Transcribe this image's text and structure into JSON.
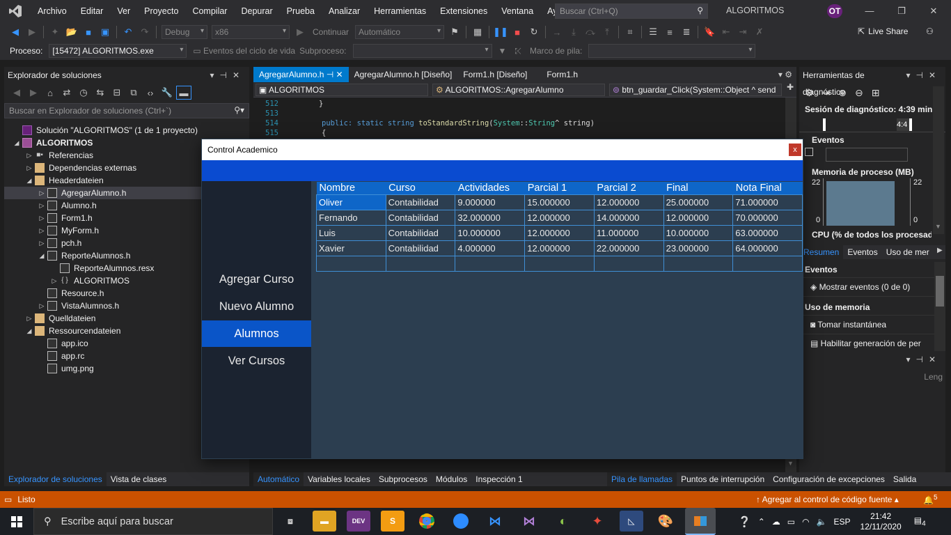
{
  "menu": {
    "items": [
      "Archivo",
      "Editar",
      "Ver",
      "Proyecto",
      "Compilar",
      "Depurar",
      "Prueba",
      "Analizar",
      "Herramientas",
      "Extensiones",
      "Ventana",
      "Ayuda"
    ],
    "search_placeholder": "Buscar (Ctrl+Q)",
    "solution_name": "ALGORITMOS",
    "user_initials": "OT"
  },
  "toolbar": {
    "config": "Debug",
    "platform": "x86",
    "continue_label": "Continuar",
    "auto_label": "Automático",
    "live_share": "Live Share"
  },
  "toolbar2": {
    "process_label": "Proceso:",
    "process_value": "[15472] ALGORITMOS.exe",
    "lifecycle": "Eventos del ciclo de vida",
    "subprocess": "Subproceso:",
    "stackframe": "Marco de pila:"
  },
  "solution_explorer": {
    "title": "Explorador de soluciones",
    "search_placeholder": "Buscar en Explorador de soluciones (Ctrl+`)",
    "nodes": [
      {
        "label": "Solución \"ALGORITMOS\" (1 de 1 proyecto)",
        "indent": 0,
        "arrow": "",
        "icon": "sln"
      },
      {
        "label": "ALGORITMOS",
        "indent": 0,
        "arrow": "◢",
        "icon": "proj",
        "bold": true
      },
      {
        "label": "Referencias",
        "indent": 1,
        "arrow": "▷",
        "icon": "ref"
      },
      {
        "label": "Dependencias externas",
        "indent": 1,
        "arrow": "▷",
        "icon": "folder"
      },
      {
        "label": "Headerdateien",
        "indent": 1,
        "arrow": "◢",
        "icon": "folder"
      },
      {
        "label": "AgregarAlumno.h",
        "indent": 2,
        "arrow": "▷",
        "icon": "file",
        "selected": true
      },
      {
        "label": "Alumno.h",
        "indent": 2,
        "arrow": "▷",
        "icon": "file"
      },
      {
        "label": "Form1.h",
        "indent": 2,
        "arrow": "▷",
        "icon": "file"
      },
      {
        "label": "MyForm.h",
        "indent": 2,
        "arrow": "▷",
        "icon": "file"
      },
      {
        "label": "pch.h",
        "indent": 2,
        "arrow": "▷",
        "icon": "file"
      },
      {
        "label": "ReporteAlumnos.h",
        "indent": 2,
        "arrow": "◢",
        "icon": "file"
      },
      {
        "label": "ReporteAlumnos.resx",
        "indent": 3,
        "arrow": "",
        "icon": "file"
      },
      {
        "label": "ALGORITMOS",
        "indent": 3,
        "arrow": "▷",
        "icon": "ref"
      },
      {
        "label": "Resource.h",
        "indent": 2,
        "arrow": "",
        "icon": "file"
      },
      {
        "label": "VistaAlumnos.h",
        "indent": 2,
        "arrow": "▷",
        "icon": "file"
      },
      {
        "label": "Quelldateien",
        "indent": 1,
        "arrow": "▷",
        "icon": "folder"
      },
      {
        "label": "Ressourcendateien",
        "indent": 1,
        "arrow": "◢",
        "icon": "folder"
      },
      {
        "label": "app.ico",
        "indent": 2,
        "arrow": "",
        "icon": "file"
      },
      {
        "label": "app.rc",
        "indent": 2,
        "arrow": "",
        "icon": "file"
      },
      {
        "label": "umg.png",
        "indent": 2,
        "arrow": "",
        "icon": "file"
      }
    ],
    "bottom_tabs": [
      "Explorador de soluciones",
      "Vista de clases"
    ]
  },
  "editor": {
    "tabs": [
      "AgregarAlumno.h",
      "AgregarAlumno.h [Diseño]",
      "Form1.h [Diseño]",
      "Form1.h"
    ],
    "nav": [
      "ALGORITMOS",
      "ALGORITMOS::AgregarAlumno",
      "btn_guardar_Click(System::Object ^ send"
    ],
    "lines": [
      {
        "n": "512",
        "t": "}"
      },
      {
        "n": "513",
        "t": ""
      },
      {
        "n": "514",
        "t": "public: static string toStandardString(System::String^ string)"
      },
      {
        "n": "515",
        "t": "{"
      }
    ],
    "bottom_tabs": [
      "Automático",
      "Variables locales",
      "Subprocesos",
      "Módulos",
      "Inspección 1"
    ]
  },
  "diagnostics": {
    "title": "Herramientas de diagnóstico",
    "session": "Sesión de diagnóstico: 4:39 min...",
    "timer": "4:4",
    "events_label": "Eventos",
    "memory_label": "Memoria de proceso (MB)",
    "mem_max_left": "22",
    "mem_max_right": "22",
    "mem_min_left": "0",
    "mem_min_right": "0",
    "cpu_label": "CPU (% de todos los procesad...",
    "tabs": [
      "Resumen",
      "Eventos",
      "Uso de mer"
    ],
    "events_section": "Eventos",
    "show_events": "Mostrar eventos (0 de 0)",
    "memory_section": "Uso de memoria",
    "snapshot": "Tomar instantánea",
    "enable_gen": "Habilitar generación de per",
    "lang_label": "Leng",
    "bottom_tabs": [
      "Pila de llamadas",
      "Puntos de interrupción",
      "Configuración de excepciones",
      "Salida"
    ]
  },
  "status": {
    "ready": "Listo",
    "source_control": "Agregar al control de código fuente",
    "notif_count": "5"
  },
  "taskbar": {
    "search_placeholder": "Escribe aquí para buscar",
    "lang": "ESP",
    "time": "21:42",
    "date": "12/11/2020",
    "notif": "4"
  },
  "dialog": {
    "title": "Control Academico",
    "close": "x",
    "menu": [
      "Agregar Curso",
      "Nuevo Alumno",
      "Alumnos",
      "Ver Cursos"
    ],
    "active_menu": "Alumnos",
    "columns": [
      "Nombre",
      "Curso",
      "Actividades",
      "Parcial 1",
      "Parcial 2",
      "Final",
      "Nota Final"
    ],
    "rows": [
      [
        "Oliver",
        "Contabilidad",
        "9.000000",
        "15.000000",
        "12.000000",
        "25.000000",
        "71.000000"
      ],
      [
        "Fernando",
        "Contabilidad",
        "32.000000",
        "12.000000",
        "14.000000",
        "12.000000",
        "70.000000"
      ],
      [
        "Luis",
        "Contabilidad",
        "10.000000",
        "12.000000",
        "11.000000",
        "10.000000",
        "63.000000"
      ],
      [
        "Xavier",
        "Contabilidad",
        "4.000000",
        "12.000000",
        "22.000000",
        "23.000000",
        "64.000000"
      ],
      [
        "",
        "",
        "",
        "",
        "",
        "",
        ""
      ]
    ]
  },
  "colors": {
    "accent": "#007acc",
    "status_bar": "#ca5100",
    "dialog_blue": "#0a4bd0",
    "grid_header": "#0e66c8"
  }
}
